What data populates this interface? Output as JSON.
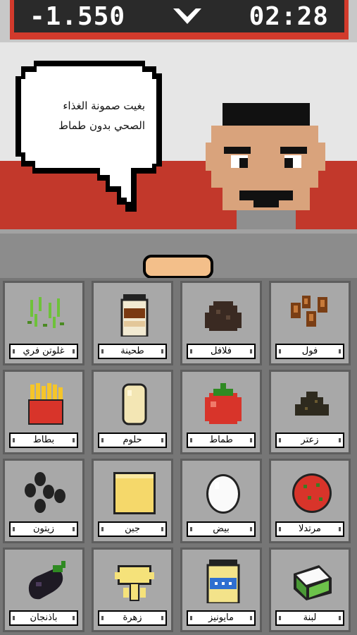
{
  "hud": {
    "score": "-1.550",
    "menu_glyph": "V",
    "timer": "02:28"
  },
  "customer": {
    "speech_lines": [
      "بغيت صمونة الغذاء",
      "الصحي بدون طماط"
    ]
  },
  "ingredients": [
    {
      "label": "فول",
      "icon": "fava-beans-icon"
    },
    {
      "label": "فلافل",
      "icon": "falafel-icon"
    },
    {
      "label": "طحينة",
      "icon": "tahini-jar-icon"
    },
    {
      "label": "غلوتن فري",
      "icon": "gluten-free-sprouts-icon"
    },
    {
      "label": "زعتر",
      "icon": "zaatar-icon"
    },
    {
      "label": "طماط",
      "icon": "tomato-icon"
    },
    {
      "label": "حلوم",
      "icon": "halloumi-icon"
    },
    {
      "label": "بطاط",
      "icon": "fries-icon"
    },
    {
      "label": "مرتدلا",
      "icon": "mortadella-icon"
    },
    {
      "label": "بيض",
      "icon": "egg-icon"
    },
    {
      "label": "جبن",
      "icon": "cheese-icon"
    },
    {
      "label": "زيتون",
      "icon": "olives-icon"
    },
    {
      "label": "لبنة",
      "icon": "labneh-icon"
    },
    {
      "label": "مايونيز",
      "icon": "mayonnaise-icon"
    },
    {
      "label": "زهرة",
      "icon": "cauliflower-icon"
    },
    {
      "label": "باذنجان",
      "icon": "eggplant-icon"
    }
  ]
}
